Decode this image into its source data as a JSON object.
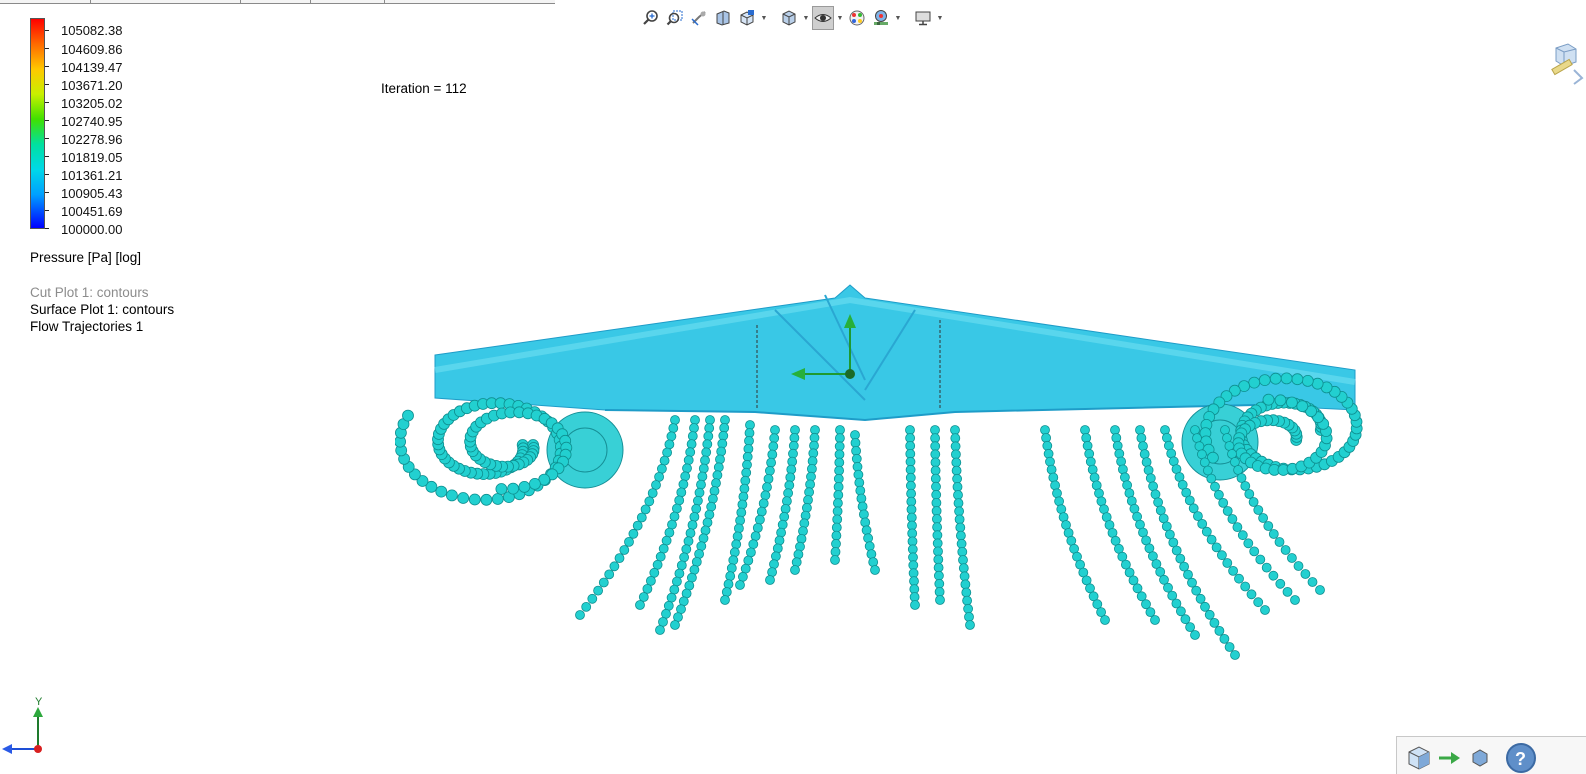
{
  "legend": {
    "title": "Pressure [Pa] [log]",
    "values": [
      "105082.38",
      "104609.86",
      "104139.47",
      "103671.20",
      "103205.02",
      "102740.95",
      "102278.96",
      "101819.05",
      "101361.21",
      "100905.43",
      "100451.69",
      "100000.00"
    ]
  },
  "features": [
    {
      "label": "Cut Plot 1: contours",
      "dimmed": true
    },
    {
      "label": "Surface Plot 1: contours",
      "dimmed": false
    },
    {
      "label": "Flow Trajectories 1",
      "dimmed": false
    }
  ],
  "iteration_text": "Iteration = 112",
  "triad": {
    "y_label": "Y"
  },
  "colors": {
    "particle": "#22d0d0",
    "particle_edge": "#0f8f90",
    "surface": "#39c8e6",
    "surface_dark": "#1e9cc8"
  },
  "toolbar_icons": [
    "zoom-to-fit-icon",
    "zoom-to-area-icon",
    "previous-view-icon",
    "section-view-icon",
    "view-orientation-icon",
    "display-style-icon",
    "hide-show-items-icon",
    "edit-appearance-icon",
    "apply-scene-icon",
    "view-settings-icon"
  ]
}
